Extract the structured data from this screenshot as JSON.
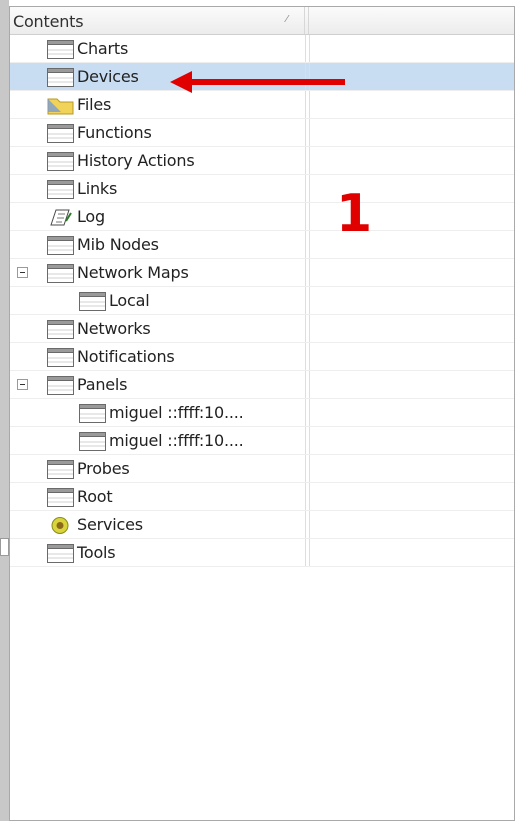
{
  "panel": {
    "header_title": "Contents",
    "header_sort_glyph": "⁄"
  },
  "tree": {
    "items": [
      {
        "label": "Charts",
        "icon": "table-icon",
        "level": 1
      },
      {
        "label": "Devices",
        "icon": "table-icon",
        "level": 1,
        "selected": true
      },
      {
        "label": "Files",
        "icon": "folder-icon",
        "level": 1
      },
      {
        "label": "Functions",
        "icon": "table-icon",
        "level": 1
      },
      {
        "label": "History Actions",
        "icon": "table-icon",
        "level": 1
      },
      {
        "label": "Links",
        "icon": "table-icon",
        "level": 1
      },
      {
        "label": "Log",
        "icon": "log-icon",
        "level": 1
      },
      {
        "label": "Mib Nodes",
        "icon": "table-icon",
        "level": 1
      },
      {
        "label": "Network Maps",
        "icon": "table-icon",
        "level": 1,
        "expanded": true
      },
      {
        "label": "Local",
        "icon": "table-icon",
        "level": 2
      },
      {
        "label": "Networks",
        "icon": "table-icon",
        "level": 1
      },
      {
        "label": "Notifications",
        "icon": "table-icon",
        "level": 1
      },
      {
        "label": "Panels",
        "icon": "table-icon",
        "level": 1,
        "expanded": true
      },
      {
        "label": "miguel ::ffff:10....",
        "icon": "table-icon",
        "level": 2
      },
      {
        "label": "miguel ::ffff:10....",
        "icon": "table-icon",
        "level": 2
      },
      {
        "label": "Probes",
        "icon": "table-icon",
        "level": 1
      },
      {
        "label": "Root",
        "icon": "table-icon",
        "level": 1
      },
      {
        "label": "Services",
        "icon": "services-icon",
        "level": 1
      },
      {
        "label": "Tools",
        "icon": "table-icon",
        "level": 1
      }
    ]
  },
  "annotation": {
    "number": "1",
    "color": "#e00000",
    "arrow_target": "Devices"
  },
  "colors": {
    "selection": "#c9ddf2",
    "annotation_red": "#e00000"
  }
}
